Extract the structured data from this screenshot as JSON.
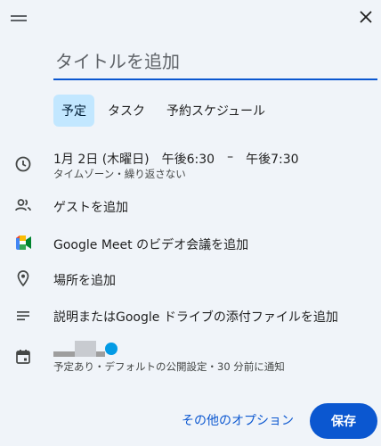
{
  "header": {
    "drag_icon": "drag-handle-icon",
    "close_icon": "close-icon"
  },
  "title": {
    "placeholder": "タイトルを追加",
    "value": ""
  },
  "tabs": [
    {
      "label": "予定",
      "active": true
    },
    {
      "label": "タスク",
      "active": false
    },
    {
      "label": "予約スケジュール",
      "active": false
    }
  ],
  "datetime": {
    "date": "1月 2日 (木曜日)",
    "start": "午後6:30",
    "separator": "–",
    "end": "午後7:30",
    "sub": "タイムゾーン・繰り返さない"
  },
  "guests": {
    "label": "ゲストを追加"
  },
  "meet": {
    "label": "Google Meet のビデオ会議を追加"
  },
  "location": {
    "label": "場所を追加"
  },
  "description": {
    "label": "説明またはGoogle ドライブの添付ファイルを追加"
  },
  "calendar": {
    "sub": "予定あり・デフォルトの公開設定・30 分前に通知",
    "dot_color": "#039be5"
  },
  "footer": {
    "more_options": "その他のオプション",
    "save": "保存"
  },
  "colors": {
    "accent": "#0b57d0",
    "tab_active_bg": "#c2e7ff",
    "background": "#f0f4f9"
  }
}
